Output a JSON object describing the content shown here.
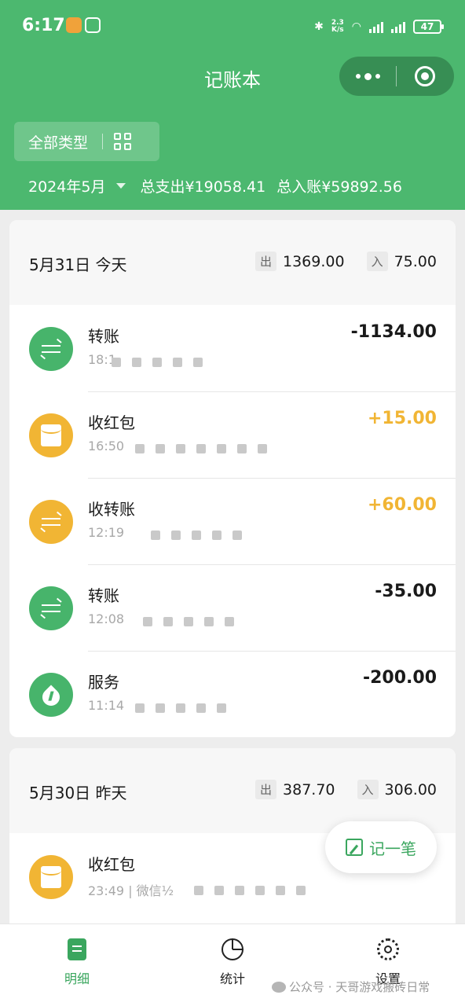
{
  "status_bar": {
    "time": "6:17",
    "speed_value": "2.3",
    "speed_unit": "K/s",
    "battery": "47"
  },
  "nav": {
    "title": "记账本"
  },
  "filter": {
    "label": "全部类型"
  },
  "summary": {
    "month": "2024年5月",
    "expense": "总支出¥19058.41",
    "income": "总入账¥59892.56"
  },
  "days": [
    {
      "title": "5月31日 今天",
      "out_tag": "出",
      "out_total": "1369.00",
      "in_tag": "入",
      "in_total": "75.00",
      "items": [
        {
          "title": "转账",
          "time": "18:1",
          "method": "",
          "amount": "-1134.00",
          "icon": "transfer-icon",
          "color": "#47b46b"
        },
        {
          "title": "收红包",
          "time": "16:50",
          "method": "",
          "amount": "+15.00",
          "icon": "red-packet-icon",
          "color": "#f1b534"
        },
        {
          "title": "收转账",
          "time": "12:19",
          "method": "",
          "amount": "+60.00",
          "icon": "transfer-icon",
          "color": "#f1b534"
        },
        {
          "title": "转账",
          "time": "12:08",
          "method": "",
          "amount": "-35.00",
          "icon": "transfer-icon",
          "color": "#47b46b"
        },
        {
          "title": "服务",
          "time": "11:14",
          "method": "",
          "amount": "-200.00",
          "icon": "service-icon",
          "color": "#47b46b"
        }
      ]
    },
    {
      "title": "5月30日 昨天",
      "out_tag": "出",
      "out_total": "387.70",
      "in_tag": "入",
      "in_total": "306.00",
      "items": [
        {
          "title": "收红包",
          "time": "23:49",
          "method": "| 微信½",
          "amount": "",
          "icon": "red-packet-icon",
          "color": "#f1b534"
        }
      ]
    }
  ],
  "fab": {
    "label": "记一笔"
  },
  "tabs": [
    {
      "label": "明细",
      "active": true
    },
    {
      "label": "统计",
      "active": false
    },
    {
      "label": "设置",
      "active": false
    }
  ],
  "watermark": {
    "text": "公众号 · 天哥游戏搬砖日常"
  },
  "colors": {
    "brand_green": "#4cb86f",
    "income_yellow": "#f1b534",
    "expense_icon_green": "#47b46b"
  }
}
